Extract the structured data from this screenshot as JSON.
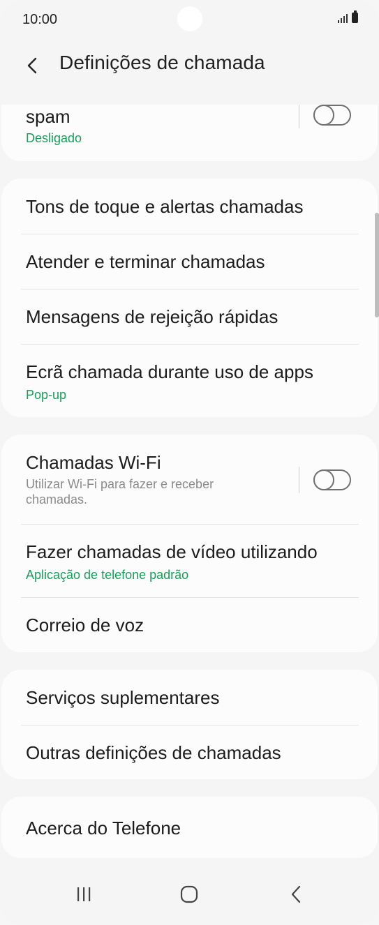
{
  "status_bar": {
    "time": "10:00"
  },
  "header": {
    "title": "Definições de chamada"
  },
  "sections": {
    "spam": {
      "title": "spam",
      "subtitle": "Desligado",
      "toggle_state": "off"
    },
    "group1": [
      {
        "title": "Tons de toque e alertas chamadas"
      },
      {
        "title": "Atender e terminar chamadas"
      },
      {
        "title": "Mensagens de rejeição rápidas"
      },
      {
        "title": "Ecrã chamada durante uso de apps",
        "subtitle": "Pop-up"
      }
    ],
    "wifi": {
      "title": "Chamadas Wi-Fi",
      "description": "Utilizar Wi-Fi para fazer e receber chamadas.",
      "toggle_state": "off"
    },
    "video": {
      "title": "Fazer chamadas de vídeo utilizando",
      "subtitle": "Aplicação de telefone padrão"
    },
    "voicemail": {
      "title": "Correio de voz"
    },
    "group3": [
      {
        "title": "Serviços suplementares"
      },
      {
        "title": "Outras definições de chamadas"
      }
    ],
    "about": {
      "title": "Acerca do Telefone"
    }
  },
  "nav_bar": {
    "recents_icon": "recent-apps-icon",
    "home_icon": "home-icon",
    "back_icon": "back-icon"
  },
  "colors": {
    "accent_green": "#16a05a",
    "background": "#f5f5f5",
    "card": "#fcfcfc"
  }
}
